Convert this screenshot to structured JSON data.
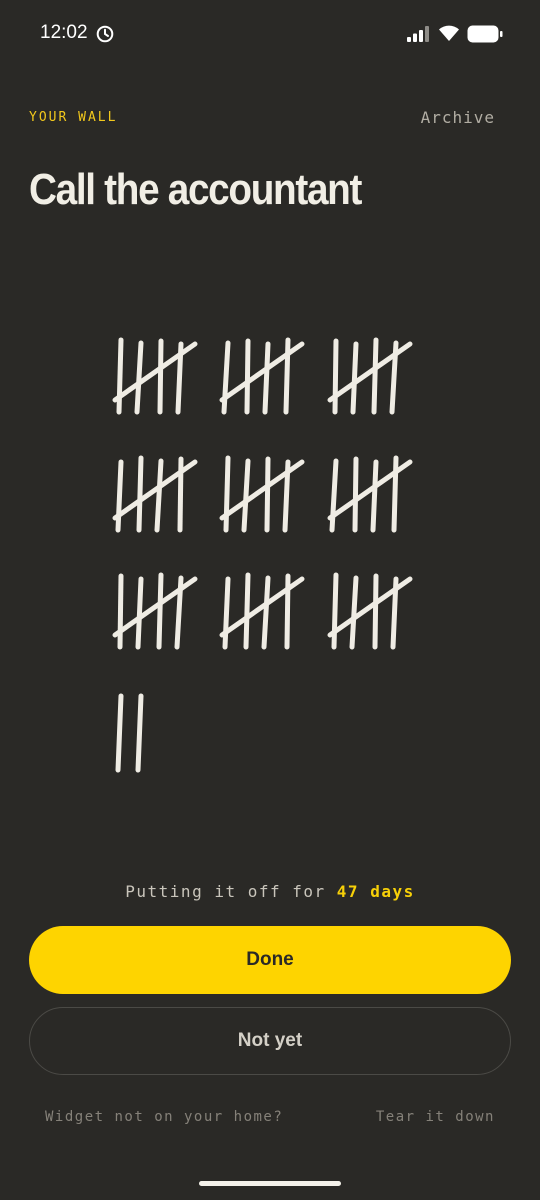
{
  "status_bar": {
    "time": "12:02",
    "icons": [
      "alarm-clock-icon",
      "cellular-signal-icon",
      "wifi-icon",
      "battery-icon"
    ]
  },
  "header": {
    "section_label": "YOUR WALL",
    "archive_label": "Archive"
  },
  "task": {
    "title": "Call the accountant",
    "tally_count": 47
  },
  "counter": {
    "prefix": "Putting it off for",
    "days": "47 days"
  },
  "actions": {
    "done_label": "Done",
    "not_yet_label": "Not yet"
  },
  "footer": {
    "widget_link": "Widget not on your home?",
    "tear_down_link": "Tear it down"
  },
  "colors": {
    "background": "#2a2926",
    "accent": "#fed400",
    "chalk": "#efece4"
  }
}
